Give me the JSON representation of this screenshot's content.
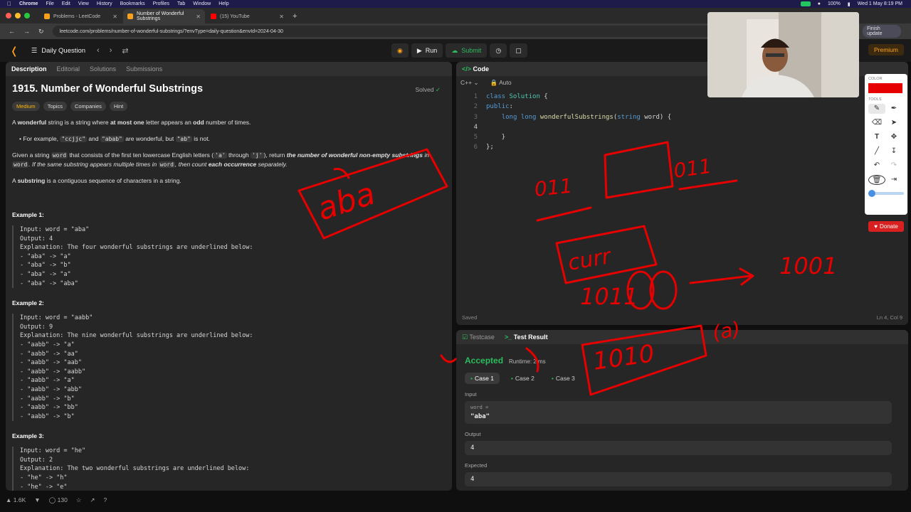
{
  "menubar": {
    "app": "Chrome",
    "items": [
      "File",
      "Edit",
      "View",
      "History",
      "Bookmarks",
      "Profiles",
      "Tab",
      "Window",
      "Help"
    ],
    "battery": "100%",
    "datetime": "Wed 1 May  8:19 PM"
  },
  "tabs": [
    {
      "title": "Problems - LeetCode",
      "active": false
    },
    {
      "title": "Number of Wonderful Substrings",
      "active": true
    },
    {
      "title": "(15) YouTube",
      "active": false
    }
  ],
  "address": {
    "url": "leetcode.com/problems/number-of-wonderful-substrings/?envType=daily-question&envId=2024-04-30",
    "update_label": "Finish update"
  },
  "nav": {
    "daily_label": "Daily Question",
    "run_label": "Run",
    "submit_label": "Submit",
    "premium_label": "Premium"
  },
  "left_tabs": [
    "Description",
    "Editorial",
    "Solutions",
    "Submissions"
  ],
  "problem": {
    "title": "1915. Number of Wonderful Substrings",
    "status": "Solved",
    "chips": [
      "Medium",
      "Topics",
      "Companies",
      "Hint"
    ],
    "p1_a": "A ",
    "p1_b": "wonderful",
    "p1_c": " string is a string where ",
    "p1_d": "at most one",
    "p1_e": " letter appears an ",
    "p1_f": "odd",
    "p1_g": " number of times.",
    "bullet_a": "For example, ",
    "bullet_code1": "\"ccjjc\"",
    "bullet_b": " and ",
    "bullet_code2": "\"abab\"",
    "bullet_c": " are wonderful, but ",
    "bullet_code3": "\"ab\"",
    "bullet_d": " is not.",
    "p2_a": "Given a string ",
    "p2_code1": "word",
    "p2_b": " that consists of the first ten lowercase English letters (",
    "p2_code2": "'a'",
    "p2_c": " through ",
    "p2_code3": "'j'",
    "p2_d": "), return ",
    "p2_e": "the number of wonderful non-empty substrings",
    "p2_f": " in ",
    "p2_code4": "word",
    "p2_g": ". If the same substring appears multiple times in ",
    "p2_code5": "word",
    "p2_h": ", then count ",
    "p2_i": "each occurrence",
    "p2_j": " separately.",
    "p3_a": "A ",
    "p3_b": "substring",
    "p3_c": " is a contiguous sequence of characters in a string.",
    "examples": [
      {
        "heading": "Example 1:",
        "text": "Input: word = \"aba\"\nOutput: 4\nExplanation: The four wonderful substrings are underlined below:\n- \"aba\" -> \"a\"\n- \"aba\" -> \"b\"\n- \"aba\" -> \"a\"\n- \"aba\" -> \"aba\""
      },
      {
        "heading": "Example 2:",
        "text": "Input: word = \"aabb\"\nOutput: 9\nExplanation: The nine wonderful substrings are underlined below:\n- \"aabb\" -> \"a\"\n- \"aabb\" -> \"aa\"\n- \"aabb\" -> \"aab\"\n- \"aabb\" -> \"aabb\"\n- \"aabb\" -> \"a\"\n- \"aabb\" -> \"abb\"\n- \"aabb\" -> \"b\"\n- \"aabb\" -> \"bb\"\n- \"aabb\" -> \"b\""
      },
      {
        "heading": "Example 3:",
        "text": "Input: word = \"he\"\nOutput: 2\nExplanation: The two wonderful substrings are underlined below:\n- \"he\" -> \"h\"\n- \"he\" -> \"e\""
      }
    ],
    "likes": "1.6K",
    "comments": "130"
  },
  "editor": {
    "tab_label": "Code",
    "language": "C++",
    "mode": "Auto",
    "line_numbers": [
      "1",
      "2",
      "3",
      "4",
      "5",
      "6"
    ],
    "saved_label": "Saved",
    "cursor_pos": "Ln 4, Col 9"
  },
  "result": {
    "tabs": [
      "Testcase",
      "Test Result"
    ],
    "status": "Accepted",
    "runtime": "Runtime: 2 ms",
    "cases": [
      "Case 1",
      "Case 2",
      "Case 3"
    ],
    "input_label": "Input",
    "input_var": "word =",
    "input_value": "\"aba\"",
    "output_label": "Output",
    "output_value": "4",
    "expected_label": "Expected",
    "expected_value": "4"
  },
  "toolbox": {
    "color_label": "COLOR",
    "tools_label": "TOOLS",
    "color": "#e60000",
    "donate_label": "Donate"
  },
  "annotations": {
    "aba": "aba",
    "ones_left": "011",
    "ones_right": "011",
    "curr": "curr",
    "bits1": "1011",
    "bits2": "1001",
    "bits3": "1010",
    "letter": "(a)"
  }
}
